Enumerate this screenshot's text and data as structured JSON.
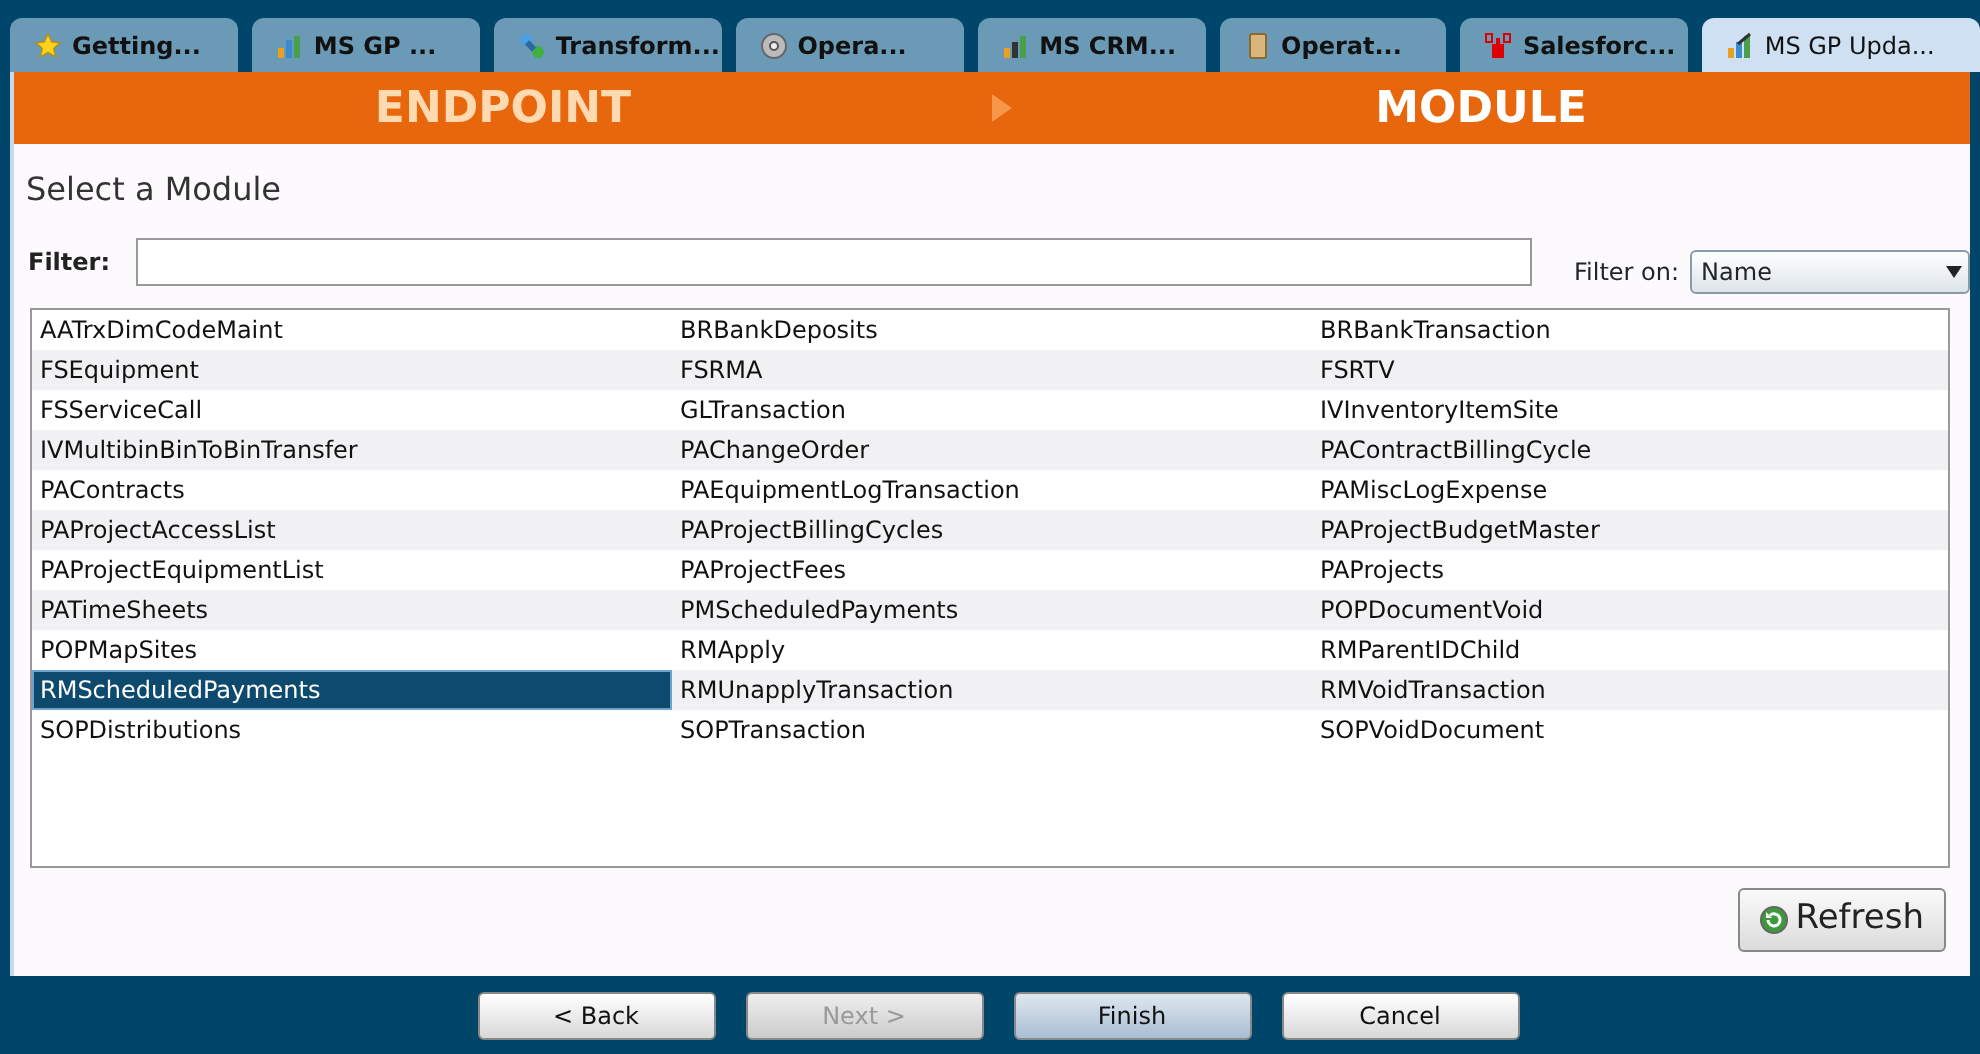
{
  "tabs": [
    {
      "label": "Getting...",
      "selected": false
    },
    {
      "label": "MS GP ...",
      "selected": false
    },
    {
      "label": "Transform...",
      "selected": false
    },
    {
      "label": "Opera...",
      "selected": false
    },
    {
      "label": "MS CRM...",
      "selected": false
    },
    {
      "label": "Operat...",
      "selected": false
    },
    {
      "label": "Salesforc...",
      "selected": false
    },
    {
      "label": "MS GP Upda...",
      "selected": true
    }
  ],
  "steps": [
    {
      "label": "ENDPOINT",
      "selected": false
    },
    {
      "label": "MODULE",
      "selected": true
    }
  ],
  "heading": "Select a Module",
  "filter": {
    "label": "Filter:"
  },
  "filter_on": {
    "label": "Filter on:",
    "value": "Name"
  },
  "modules": [
    {
      "name": "AATrxDimCodeMaint",
      "selected": false
    },
    {
      "name": "BRBankDeposits",
      "selected": false
    },
    {
      "name": "BRBankTransaction",
      "selected": false
    },
    {
      "name": "FSEquipment",
      "selected": false
    },
    {
      "name": "FSRMA",
      "selected": false
    },
    {
      "name": "FSRTV",
      "selected": false
    },
    {
      "name": "FSServiceCall",
      "selected": false
    },
    {
      "name": "GLTransaction",
      "selected": false
    },
    {
      "name": "IVInventoryItemSite",
      "selected": false
    },
    {
      "name": "IVMultibinBinToBinTransfer",
      "selected": false
    },
    {
      "name": "PAChangeOrder",
      "selected": false
    },
    {
      "name": "PAContractBillingCycle",
      "selected": false
    },
    {
      "name": "PAContracts",
      "selected": false
    },
    {
      "name": "PAEquipmentLogTransaction",
      "selected": false
    },
    {
      "name": "PAMiscLogExpense",
      "selected": false
    },
    {
      "name": "PAProjectAccessList",
      "selected": false
    },
    {
      "name": "PAProjectBillingCycles",
      "selected": false
    },
    {
      "name": "PAProjectBudgetMaster",
      "selected": false
    },
    {
      "name": "PAProjectEquipmentList",
      "selected": false
    },
    {
      "name": "PAProjectFees",
      "selected": false
    },
    {
      "name": "PAProjects",
      "selected": false
    },
    {
      "name": "PATimeSheets",
      "selected": false
    },
    {
      "name": "PMScheduledPayments",
      "selected": false
    },
    {
      "name": "POPDocumentVoid",
      "selected": false
    },
    {
      "name": "POPMapSites",
      "selected": false
    },
    {
      "name": "RMApply",
      "selected": false
    },
    {
      "name": "RMParentIDChild",
      "selected": false
    },
    {
      "name": "RMScheduledPayments",
      "selected": true
    },
    {
      "name": "RMUnapplyTransaction",
      "selected": false
    },
    {
      "name": "RMVoidTransaction",
      "selected": false
    },
    {
      "name": "SOPDistributions",
      "selected": false
    },
    {
      "name": "SOPTransaction",
      "selected": false
    },
    {
      "name": "SOPVoidDocument",
      "selected": false
    }
  ],
  "refresh_button": "Refresh",
  "buttons": [
    {
      "label": "< Back",
      "disabled": false,
      "default": false
    },
    {
      "label": "Next >",
      "disabled": true,
      "default": false
    },
    {
      "label": "Finish",
      "disabled": false,
      "default": true
    },
    {
      "label": "Cancel",
      "disabled": false,
      "default": false
    }
  ]
}
